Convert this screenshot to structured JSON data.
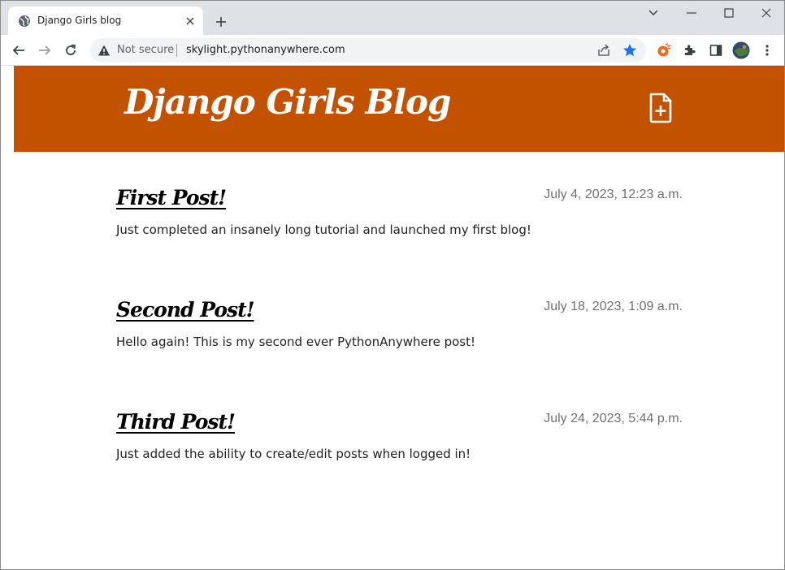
{
  "browser": {
    "tab_title": "Django Girls blog",
    "security_label": "Not secure",
    "url": "skylight.pythonanywhere.com"
  },
  "site": {
    "title": "Django Girls Blog",
    "brand_color": "#c25100"
  },
  "posts": [
    {
      "title": "First Post!",
      "date": "July 4, 2023, 12:23 a.m.",
      "text": "Just completed an insanely long tutorial and launched my first blog!"
    },
    {
      "title": "Second Post!",
      "date": "July 18, 2023, 1:09 a.m.",
      "text": "Hello again! This is my second ever PythonAnywhere post!"
    },
    {
      "title": "Third Post!",
      "date": "July 24, 2023, 5:44 p.m.",
      "text": "Just added the ability to create/edit posts when logged in!"
    }
  ],
  "icons": {
    "tab": "globe-icon",
    "new_post": "file-plus-icon",
    "nav": [
      "back-arrow-icon",
      "forward-arrow-icon",
      "reload-icon"
    ],
    "extensions": [
      "extension-fox-icon",
      "puzzle-icon",
      "side-panel-icon",
      "profile-avatar",
      "kebab-menu-icon"
    ]
  }
}
